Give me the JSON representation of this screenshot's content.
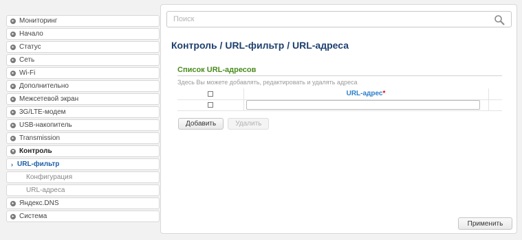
{
  "sidebar": {
    "items": [
      {
        "label": "Мониторинг"
      },
      {
        "label": "Начало"
      },
      {
        "label": "Статус"
      },
      {
        "label": "Сеть"
      },
      {
        "label": "Wi-Fi"
      },
      {
        "label": "Дополнительно"
      },
      {
        "label": "Межсетевой экран"
      },
      {
        "label": "3G/LTE-модем"
      },
      {
        "label": "USB-накопитель"
      },
      {
        "label": "Transmission"
      },
      {
        "label": "Контроль"
      },
      {
        "label": "URL-фильтр"
      },
      {
        "label": "Конфигурация"
      },
      {
        "label": "URL-адреса"
      },
      {
        "label": "Яндекс.DNS"
      },
      {
        "label": "Система"
      }
    ]
  },
  "search": {
    "placeholder": "Поиск"
  },
  "breadcrumb": {
    "text": "Контроль /  URL-фильтр /  URL-адреса"
  },
  "section": {
    "title": "Список URL-адресов",
    "description": "Здесь Вы можете добавлять, редактировать и удалять адреса",
    "column_header": "URL-адрес",
    "required_mark": "*",
    "url_value": ""
  },
  "buttons": {
    "add": "Добавить",
    "delete": "Удалить",
    "apply": "Применить"
  },
  "colors": {
    "accent_blue": "#1d5fa8",
    "section_green": "#4a8b1d",
    "title_navy": "#1d3f6e",
    "required_red": "#dd0000"
  }
}
